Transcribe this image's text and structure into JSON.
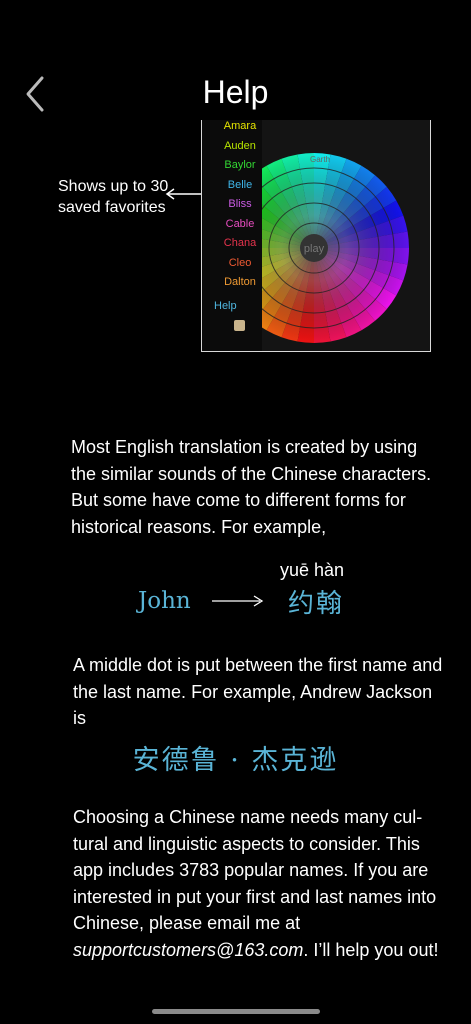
{
  "header": {
    "title": "Help"
  },
  "annotation": {
    "line1": "Shows up to 30",
    "line2": "saved favorites"
  },
  "screenshot": {
    "names": [
      {
        "label": "Amara",
        "color": "#e6e600"
      },
      {
        "label": "Auden",
        "color": "#b8e600"
      },
      {
        "label": "Baylor",
        "color": "#33d633"
      },
      {
        "label": "Belle",
        "color": "#3fb5e8"
      },
      {
        "label": "Bliss",
        "color": "#cc5ce6"
      },
      {
        "label": "Cable",
        "color": "#e64dbf"
      },
      {
        "label": "Chana",
        "color": "#e6334d"
      },
      {
        "label": "Cleo",
        "color": "#ef5a33"
      },
      {
        "label": "Dalton",
        "color": "#ef9a33"
      }
    ],
    "help_label": "Help",
    "wheel_top_label": "Garth",
    "wheel_center_label": "play"
  },
  "body": {
    "p1": "Most English translation is created by using the similar sounds of the Chinese characters. But some have come to different forms for historical reasons. For example,",
    "example1": {
      "pinyin": "yuē hàn",
      "english": "John",
      "chinese": "约翰"
    },
    "p2": "A middle dot is put between the first name and the last name. For example, Andrew Jackson is",
    "example2": {
      "chinese": "安德鲁 · 杰克逊"
    },
    "p3_text": "Choosing a Chinese name needs many cul-tural and linguistic aspects to consider. This app includes 3783 popular names. If you are interested in put your first and last names into Chinese, please email me at ",
    "p3_email": "supportcustomers@163.com",
    "p3_end": ". I’ll help you out!"
  }
}
